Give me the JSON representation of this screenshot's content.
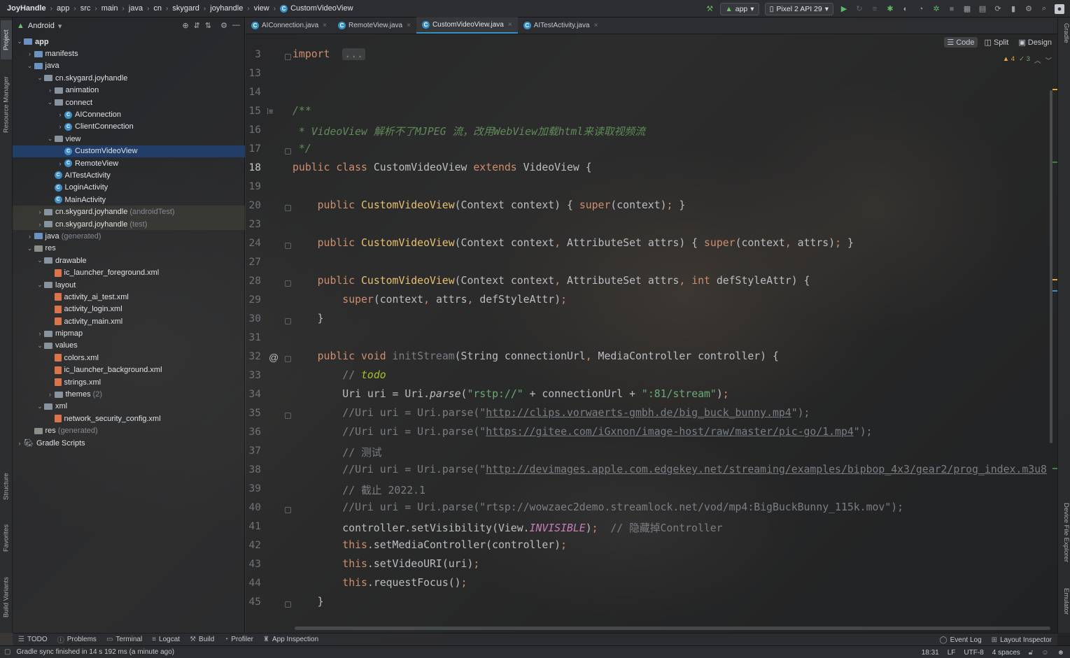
{
  "breadcrumb": [
    "JoyHandle",
    "app",
    "src",
    "main",
    "java",
    "cn",
    "skygard",
    "joyhandle",
    "view",
    "CustomVideoView"
  ],
  "run_config": "app",
  "device": "Pixel 2 API 29",
  "project_panel": {
    "view_mode": "Android",
    "tree": [
      {
        "indent": 0,
        "chev": "open",
        "icon": "folder-module",
        "label": "app",
        "bold": true
      },
      {
        "indent": 1,
        "chev": "closed",
        "icon": "folder-blue",
        "label": "manifests"
      },
      {
        "indent": 1,
        "chev": "open",
        "icon": "folder-blue",
        "label": "java"
      },
      {
        "indent": 2,
        "chev": "open",
        "icon": "folder",
        "label": "cn.skygard.joyhandle"
      },
      {
        "indent": 3,
        "chev": "closed",
        "icon": "folder",
        "label": "animation"
      },
      {
        "indent": 3,
        "chev": "open",
        "icon": "folder",
        "label": "connect"
      },
      {
        "indent": 4,
        "chev": "closed",
        "icon": "class",
        "label": "AIConnection"
      },
      {
        "indent": 4,
        "chev": "closed",
        "icon": "class",
        "label": "ClientConnection"
      },
      {
        "indent": 3,
        "chev": "open",
        "icon": "folder",
        "label": "view"
      },
      {
        "indent": 4,
        "chev": "none",
        "icon": "class",
        "label": "CustomVideoView",
        "selected": true
      },
      {
        "indent": 4,
        "chev": "closed",
        "icon": "class",
        "label": "RemoteView"
      },
      {
        "indent": 3,
        "chev": "none",
        "icon": "class",
        "label": "AITestActivity"
      },
      {
        "indent": 3,
        "chev": "none",
        "icon": "class",
        "label": "LoginActivity"
      },
      {
        "indent": 3,
        "chev": "none",
        "icon": "class",
        "label": "MainActivity"
      },
      {
        "indent": 2,
        "chev": "closed",
        "icon": "folder",
        "label": "cn.skygard.joyhandle",
        "suffix": "(androidTest)",
        "test": true
      },
      {
        "indent": 2,
        "chev": "closed",
        "icon": "folder",
        "label": "cn.skygard.joyhandle",
        "suffix": "(test)",
        "test": true
      },
      {
        "indent": 1,
        "chev": "closed",
        "icon": "folder-blue",
        "label": "java",
        "suffix": "(generated)"
      },
      {
        "indent": 1,
        "chev": "open",
        "icon": "folder-res",
        "label": "res"
      },
      {
        "indent": 2,
        "chev": "open",
        "icon": "folder",
        "label": "drawable"
      },
      {
        "indent": 3,
        "chev": "none",
        "icon": "xml",
        "label": "ic_launcher_foreground.xml"
      },
      {
        "indent": 2,
        "chev": "open",
        "icon": "folder",
        "label": "layout"
      },
      {
        "indent": 3,
        "chev": "none",
        "icon": "xml",
        "label": "activity_ai_test.xml"
      },
      {
        "indent": 3,
        "chev": "none",
        "icon": "xml",
        "label": "activity_login.xml"
      },
      {
        "indent": 3,
        "chev": "none",
        "icon": "xml",
        "label": "activity_main.xml"
      },
      {
        "indent": 2,
        "chev": "closed",
        "icon": "folder",
        "label": "mipmap"
      },
      {
        "indent": 2,
        "chev": "open",
        "icon": "folder",
        "label": "values"
      },
      {
        "indent": 3,
        "chev": "none",
        "icon": "xml",
        "label": "colors.xml"
      },
      {
        "indent": 3,
        "chev": "none",
        "icon": "xml",
        "label": "ic_launcher_background.xml"
      },
      {
        "indent": 3,
        "chev": "none",
        "icon": "xml",
        "label": "strings.xml"
      },
      {
        "indent": 3,
        "chev": "closed",
        "icon": "folder",
        "label": "themes",
        "suffix": "(2)"
      },
      {
        "indent": 2,
        "chev": "open",
        "icon": "folder",
        "label": "xml"
      },
      {
        "indent": 3,
        "chev": "none",
        "icon": "xml",
        "label": "network_security_config.xml"
      },
      {
        "indent": 1,
        "chev": "none",
        "icon": "folder-res",
        "label": "res",
        "suffix": "(generated)"
      },
      {
        "indent": 0,
        "chev": "closed",
        "icon": "gradle",
        "label": "Gradle Scripts"
      }
    ]
  },
  "left_strip_tabs": [
    "Project",
    "Resource Manager",
    "Structure",
    "Favorites",
    "Build Variants"
  ],
  "right_strip_tabs": [
    "Gradle",
    "Device File Explorer",
    "Emulator"
  ],
  "editor_tabs": [
    {
      "label": "AIConnection.java",
      "active": false
    },
    {
      "label": "RemoteView.java",
      "active": false
    },
    {
      "label": "CustomVideoView.java",
      "active": true
    },
    {
      "label": "AITestActivity.java",
      "active": false
    }
  ],
  "view_modes": [
    "Code",
    "Split",
    "Design"
  ],
  "inspections": {
    "warnings": "4",
    "ok": "3"
  },
  "current_line": "18",
  "code_lines": [
    {
      "n": "3",
      "tokens": [
        [
          "kw",
          "import"
        ],
        [
          "",
          "  "
        ],
        [
          "chip",
          "..."
        ]
      ]
    },
    {
      "n": "13",
      "tokens": []
    },
    {
      "n": "14",
      "tokens": []
    },
    {
      "n": "15",
      "tokens": [
        [
          "doc",
          "/**"
        ]
      ]
    },
    {
      "n": "16",
      "tokens": [
        [
          "doc",
          " * VideoView 解析不了MJPEG 流，改用WebView加载html来读取视频流"
        ]
      ]
    },
    {
      "n": "17",
      "tokens": [
        [
          "doc",
          " */"
        ]
      ]
    },
    {
      "n": "18",
      "tokens": [
        [
          "kw",
          "public class "
        ],
        [
          "",
          "CustomVideoView "
        ],
        [
          "kw",
          "extends "
        ],
        [
          "",
          "VideoView {"
        ]
      ]
    },
    {
      "n": "19",
      "tokens": []
    },
    {
      "n": "20",
      "tokens": [
        [
          "",
          "    "
        ],
        [
          "kw",
          "public "
        ],
        [
          "fn",
          "CustomVideoView"
        ],
        [
          "",
          "(Context context) { "
        ],
        [
          "kw",
          "super"
        ],
        [
          "",
          "(context)"
        ],
        [
          "kw",
          ";"
        ],
        [
          "",
          " }"
        ]
      ]
    },
    {
      "n": "23",
      "tokens": []
    },
    {
      "n": "24",
      "tokens": [
        [
          "",
          "    "
        ],
        [
          "kw",
          "public "
        ],
        [
          "fn",
          "CustomVideoView"
        ],
        [
          "",
          "(Context context"
        ],
        [
          "kw",
          ", "
        ],
        [
          "",
          "AttributeSet attrs) { "
        ],
        [
          "kw",
          "super"
        ],
        [
          "",
          "(context"
        ],
        [
          "kw",
          ", "
        ],
        [
          "",
          "attrs)"
        ],
        [
          "kw",
          ";"
        ],
        [
          "",
          " }"
        ]
      ]
    },
    {
      "n": "27",
      "tokens": []
    },
    {
      "n": "28",
      "tokens": [
        [
          "",
          "    "
        ],
        [
          "kw",
          "public "
        ],
        [
          "fn",
          "CustomVideoView"
        ],
        [
          "",
          "(Context context"
        ],
        [
          "kw",
          ", "
        ],
        [
          "",
          "AttributeSet attrs"
        ],
        [
          "kw",
          ", int "
        ],
        [
          "",
          "defStyleAttr) {"
        ]
      ]
    },
    {
      "n": "29",
      "tokens": [
        [
          "",
          "        "
        ],
        [
          "kw",
          "super"
        ],
        [
          "",
          "(context"
        ],
        [
          "kw",
          ", "
        ],
        [
          "",
          "attrs"
        ],
        [
          "kw",
          ", "
        ],
        [
          "",
          "defStyleAttr)"
        ],
        [
          "kw",
          ";"
        ]
      ]
    },
    {
      "n": "30",
      "tokens": [
        [
          "",
          "    }"
        ]
      ]
    },
    {
      "n": "31",
      "tokens": []
    },
    {
      "n": "32",
      "tokens": [
        [
          "",
          "    "
        ],
        [
          "kw",
          "public void "
        ],
        [
          "mth-muted",
          "initStream"
        ],
        [
          "",
          "(String connectionUrl"
        ],
        [
          "kw",
          ", "
        ],
        [
          "",
          "MediaController controller) {"
        ]
      ]
    },
    {
      "n": "33",
      "tokens": [
        [
          "",
          "        "
        ],
        [
          "cmt",
          "// "
        ],
        [
          "todo",
          "todo"
        ]
      ]
    },
    {
      "n": "34",
      "tokens": [
        [
          "",
          "        Uri uri = Uri."
        ],
        [
          "it",
          "parse"
        ],
        [
          "",
          "("
        ],
        [
          "str",
          "\"rstp://\""
        ],
        [
          "",
          " + connectionUrl + "
        ],
        [
          "str",
          "\":81/stream\""
        ],
        [
          "",
          ")"
        ],
        [
          "kw",
          ";"
        ]
      ]
    },
    {
      "n": "35",
      "tokens": [
        [
          "",
          "        "
        ],
        [
          "cmt",
          "//Uri uri = Uri.parse(\""
        ],
        [
          "cmt-lnk",
          "http://clips.vorwaerts-gmbh.de/big_buck_bunny.mp4"
        ],
        [
          "cmt",
          "\");"
        ]
      ]
    },
    {
      "n": "36",
      "tokens": [
        [
          "",
          "        "
        ],
        [
          "cmt",
          "//Uri uri = Uri.parse(\""
        ],
        [
          "cmt-lnk",
          "https://gitee.com/iGxnon/image-host/raw/master/pic-go/1.mp4"
        ],
        [
          "cmt",
          "\");"
        ]
      ]
    },
    {
      "n": "37",
      "tokens": [
        [
          "",
          "        "
        ],
        [
          "cmt",
          "// 测试"
        ]
      ]
    },
    {
      "n": "38",
      "tokens": [
        [
          "",
          "        "
        ],
        [
          "cmt",
          "//Uri uri = Uri.parse(\""
        ],
        [
          "cmt-lnk",
          "http://devimages.apple.com.edgekey.net/streaming/examples/bipbop_4x3/gear2/prog_index.m3u8"
        ],
        [
          "cmt",
          "\");"
        ]
      ]
    },
    {
      "n": "39",
      "tokens": [
        [
          "",
          "        "
        ],
        [
          "cmt",
          "// 截止 2022.1"
        ]
      ]
    },
    {
      "n": "40",
      "tokens": [
        [
          "",
          "        "
        ],
        [
          "cmt",
          "//Uri uri = Uri.parse(\"rtsp://wowzaec2demo.streamlock.net/vod/mp4:BigBuckBunny_115k.mov\");"
        ]
      ]
    },
    {
      "n": "41",
      "tokens": [
        [
          "",
          "        controller.setVisibility(View."
        ],
        [
          "stat",
          "INVISIBLE"
        ],
        [
          "",
          ")"
        ],
        [
          "kw",
          ";"
        ],
        [
          "",
          "  "
        ],
        [
          "cmt",
          "// 隐藏掉Controller"
        ]
      ]
    },
    {
      "n": "42",
      "tokens": [
        [
          "",
          "        "
        ],
        [
          "kw",
          "this"
        ],
        [
          "",
          ".setMediaController(controller)"
        ],
        [
          "kw",
          ";"
        ]
      ]
    },
    {
      "n": "43",
      "tokens": [
        [
          "",
          "        "
        ],
        [
          "kw",
          "this"
        ],
        [
          "",
          ".setVideoURI(uri)"
        ],
        [
          "kw",
          ";"
        ]
      ]
    },
    {
      "n": "44",
      "tokens": [
        [
          "",
          "        "
        ],
        [
          "kw",
          "this"
        ],
        [
          "",
          ".requestFocus()"
        ],
        [
          "kw",
          ";"
        ]
      ]
    },
    {
      "n": "45",
      "tokens": [
        [
          "",
          "    }"
        ]
      ]
    }
  ],
  "bottom_tools": [
    "TODO",
    "Problems",
    "Terminal",
    "Logcat",
    "Build",
    "Profiler",
    "App Inspection"
  ],
  "bottom_tools_right": [
    "Event Log",
    "Layout Inspector"
  ],
  "status": {
    "message": "Gradle sync finished in 14 s 192 ms (a minute ago)",
    "position": "18:31",
    "line_sep": "LF",
    "encoding": "UTF-8",
    "indent": "4 spaces"
  },
  "colors": {
    "accent": "#3592c4",
    "keyword": "#cf8e6d",
    "function": "#e8c070",
    "string": "#6aab73",
    "comment": "#7a7e85"
  }
}
